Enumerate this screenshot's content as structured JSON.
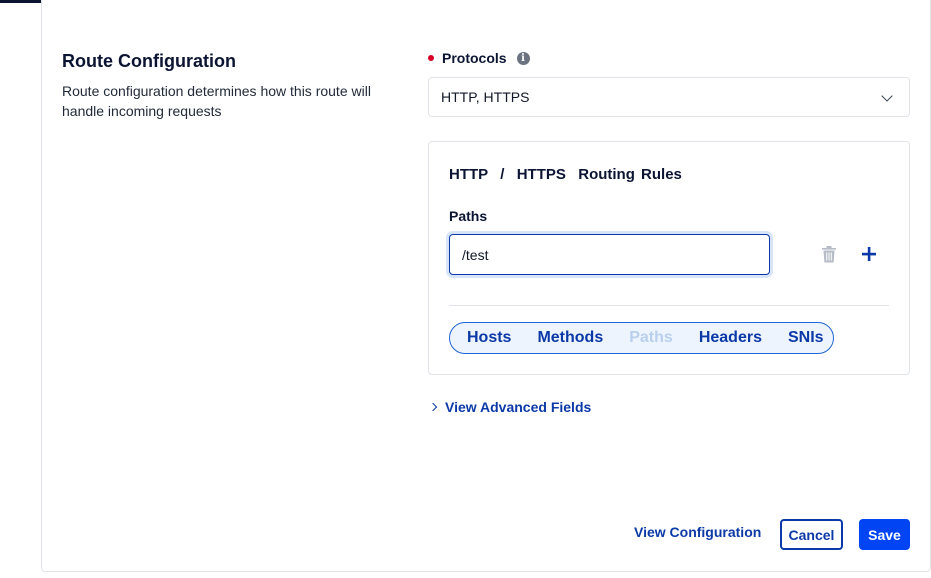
{
  "section": {
    "title": "Route Configuration",
    "description": "Route configuration determines how this route will handle incoming requests"
  },
  "protocols": {
    "label": "Protocols",
    "info_icon": "i",
    "selected": "HTTP, HTTPS"
  },
  "routing_rules": {
    "title": "HTTP  /  HTTPS  Routing Rules",
    "paths_label": "Paths",
    "path_value": "/test",
    "tabs": [
      {
        "label": "Hosts",
        "disabled": false
      },
      {
        "label": "Methods",
        "disabled": false
      },
      {
        "label": "Paths",
        "disabled": true
      },
      {
        "label": "Headers",
        "disabled": false
      },
      {
        "label": "SNIs",
        "disabled": false
      }
    ]
  },
  "advanced": {
    "label": "View Advanced Fields"
  },
  "footer": {
    "view_config_label": "View Configuration",
    "cancel_label": "Cancel",
    "save_label": "Save"
  },
  "colors": {
    "primary": "#0044f4",
    "link": "#0b3aa8",
    "required": "#d60027"
  }
}
